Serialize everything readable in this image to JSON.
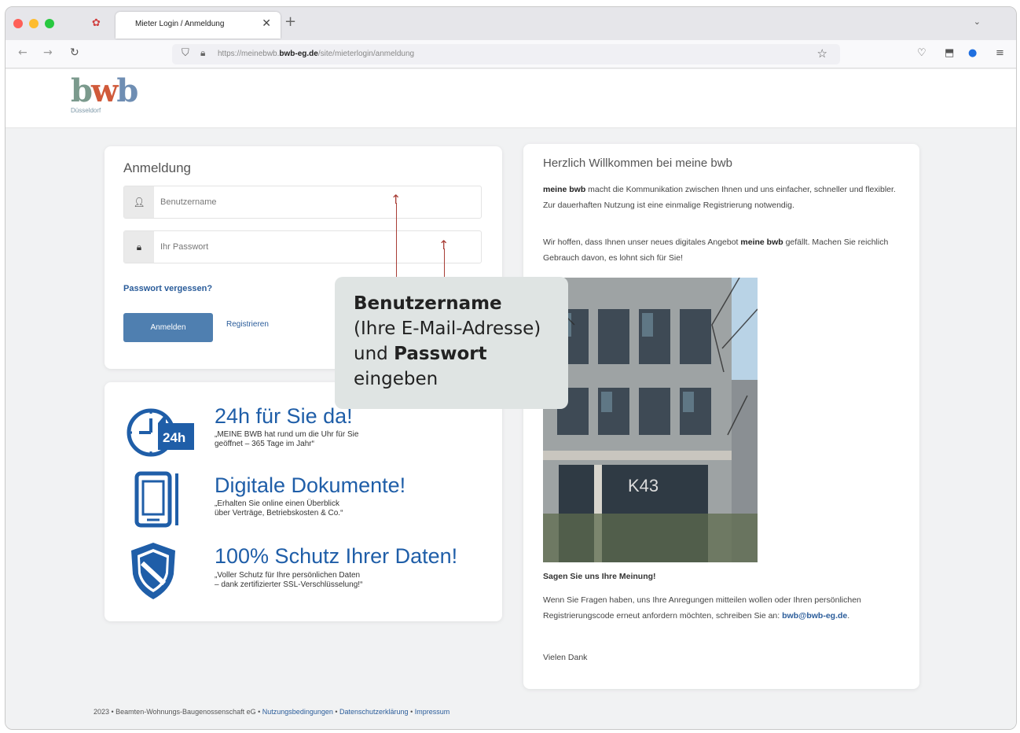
{
  "browser": {
    "tab_title": "Mieter Login / Anmeldung",
    "tab_close": "✕",
    "new_tab": "+",
    "tab_list": "⌄",
    "url_prefix": "https://meinebwb.",
    "url_domain": "bwb-eg.de",
    "url_path": "/site/mieterlogin/anmeldung",
    "icons": {
      "back": "back-arrow-icon",
      "forward": "forward-arrow-icon",
      "reload": "reload-icon",
      "shield": "tracking-shield-icon",
      "lock": "lock-icon",
      "star": "bookmark-star-icon",
      "pocket": "pocket-icon",
      "extensions": "extensions-icon",
      "account": "account-icon",
      "menu": "hamburger-menu-icon"
    }
  },
  "logo": {
    "word_b1": "b",
    "word_w": "w",
    "word_b2": "b",
    "city": "Düsseldorf"
  },
  "login": {
    "title": "Anmeldung",
    "username_placeholder": "Benutzername",
    "password_placeholder": "Ihr Passwort",
    "forgot_label": "Passwort vergessen?",
    "login_button": "Anmelden",
    "register_label": "Registrieren"
  },
  "features": [
    {
      "title": "24h für Sie da!",
      "desc": "„MEINE BWB hat rund um die Uhr für Sie\ngeöffnet – 365 Tage im Jahr“",
      "badge": "24h"
    },
    {
      "title": "Digitale Dokumente!",
      "desc": "„Erhalten Sie online einen Überblick\nüber Verträge, Betriebskosten & Co.“"
    },
    {
      "title": "100% Schutz Ihrer Daten!",
      "desc": "„Voller Schutz für Ihre persönlichen Daten\n– dank zertifizierter SSL-Verschlüsselung!“"
    }
  ],
  "welcome": {
    "title": "Herzlich Willkommen bei meine bwb",
    "p1_bold": "meine bwb",
    "p1_rest": " macht die Kommunikation zwischen Ihnen und uns einfacher, schneller und flexibler. Zur dauerhaften Nutzung ist eine einmalige Registrierung notwendig.",
    "p2_start": "Wir hoffen, dass Ihnen unser neues digitales Angebot ",
    "p2_bold": "meine bwb",
    "p2_end": " gefällt. Machen Sie reichlich Gebrauch davon, es lohnt sich für Sie!",
    "photo_sign": "K43",
    "subheading": "Sagen Sie uns Ihre Meinung!",
    "p3": "Wenn Sie Fragen haben, uns Ihre Anregungen mitteilen wollen oder Ihren persönlichen Registrierungscode erneut anfordern möchten, schreiben Sie an: ",
    "email": "bwb@bwb-eg.de",
    "p3_end": ".",
    "thanks": "Vielen Dank"
  },
  "footer": {
    "copyright": "2023 • Beamten-Wohnungs-Baugenossenschaft eG • ",
    "terms": "Nutzungsbedingungen",
    "sep": " • ",
    "privacy": "Datenschutzerklärung",
    "imprint": "Impressum"
  },
  "callout": {
    "bold1": "Benutzername",
    "line2": "(Ihre E-Mail-Adresse)",
    "line3_pre": "und ",
    "bold2": "Passwort",
    "line4": "eingeben"
  },
  "colors": {
    "accent": "#4f7fb0",
    "link": "#2a5c9a",
    "feature_blue": "#1f5ea8",
    "arrow": "#a83e36",
    "callout_bg": "#dfe4e3"
  }
}
